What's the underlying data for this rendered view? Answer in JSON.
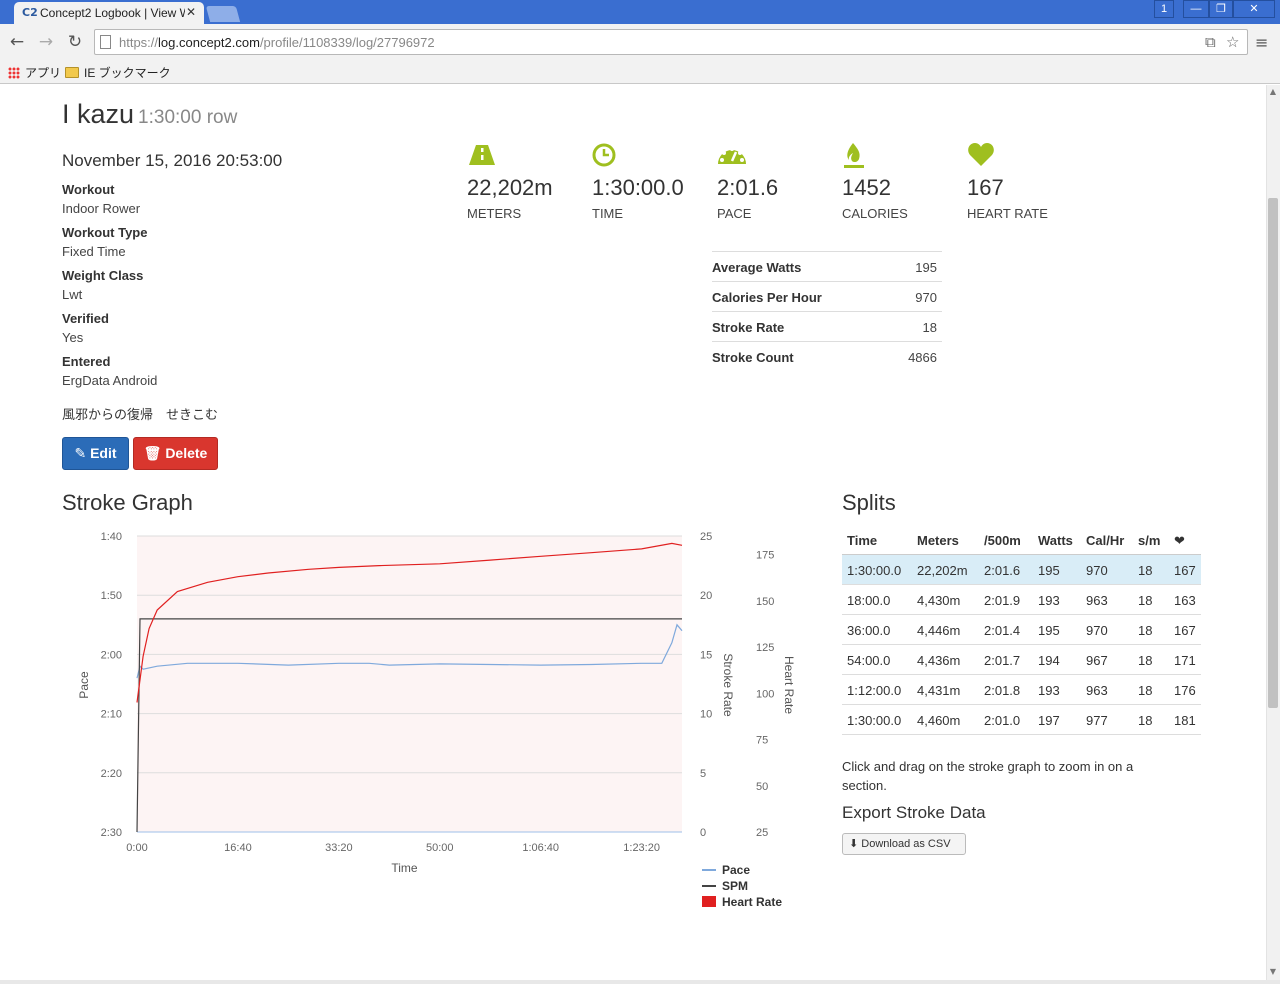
{
  "browser": {
    "tab_title": "Concept2 Logbook | View W",
    "tab_close": "✕",
    "url_scheme": "https://",
    "url_host": "log.concept2.com",
    "url_path": "/profile/1108339/log/27796972",
    "window_buttons": [
      "1",
      "—",
      "❐",
      "✕"
    ],
    "bookmarks": [
      {
        "label": "アプリ",
        "icon": "apps-grid-icon"
      },
      {
        "label": "IE ブックマーク",
        "icon": "folder-icon"
      }
    ]
  },
  "workout": {
    "name": "I kazu",
    "type_summary": "1:30:00 row",
    "date": "November 15, 2016 20:53:00",
    "details": [
      {
        "label": "Workout",
        "value": "Indoor Rower"
      },
      {
        "label": "Workout Type",
        "value": "Fixed Time"
      },
      {
        "label": "Weight Class",
        "value": "Lwt"
      },
      {
        "label": "Verified",
        "value": "Yes"
      },
      {
        "label": "Entered",
        "value": "ErgData Android"
      }
    ],
    "comment": "風邪からの復帰　せきこむ",
    "edit_label": "Edit",
    "delete_label": "Delete"
  },
  "stats": [
    {
      "value": "22,202m",
      "label": "METERS",
      "icon": "road-icon"
    },
    {
      "value": "1:30:00.0",
      "label": "TIME",
      "icon": "clock-icon"
    },
    {
      "value": "2:01.6",
      "label": "PACE",
      "icon": "speedometer-icon"
    },
    {
      "value": "1452",
      "label": "CALORIES",
      "icon": "flame-icon"
    },
    {
      "value": "167",
      "label": "HEART RATE",
      "icon": "heart-icon"
    }
  ],
  "metrics": [
    {
      "label": "Average Watts",
      "value": "195"
    },
    {
      "label": "Calories Per Hour",
      "value": "970"
    },
    {
      "label": "Stroke Rate",
      "value": "18"
    },
    {
      "label": "Stroke Count",
      "value": "4866"
    }
  ],
  "stroke_graph": {
    "heading": "Stroke Graph"
  },
  "splits": {
    "heading": "Splits",
    "columns": [
      "Time",
      "Meters",
      "/500m",
      "Watts",
      "Cal/Hr",
      "s/m",
      "heart-icon"
    ],
    "rows": [
      [
        "1:30:00.0",
        "22,202m",
        "2:01.6",
        "195",
        "970",
        "18",
        "167"
      ],
      [
        "18:00.0",
        "4,430m",
        "2:01.9",
        "193",
        "963",
        "18",
        "163"
      ],
      [
        "36:00.0",
        "4,446m",
        "2:01.4",
        "195",
        "970",
        "18",
        "167"
      ],
      [
        "54:00.0",
        "4,436m",
        "2:01.7",
        "194",
        "967",
        "18",
        "171"
      ],
      [
        "1:12:00.0",
        "4,431m",
        "2:01.8",
        "193",
        "963",
        "18",
        "176"
      ],
      [
        "1:30:00.0",
        "4,460m",
        "2:01.0",
        "197",
        "977",
        "18",
        "181"
      ]
    ]
  },
  "help_text": "Click and drag on the stroke graph to zoom in on a section.",
  "export": {
    "heading": "Export Stroke Data",
    "button_label": "Download as CSV"
  },
  "colors": {
    "accent_green": "#9fbf1f",
    "pace_line": "#7fa9dc",
    "spm_line": "#444444",
    "heart_rate_line": "#e02020",
    "edit_button": "#2b6cb8",
    "delete_button": "#d9362e",
    "split_total_bg": "#d9edf7"
  },
  "chart_data": {
    "type": "line",
    "xlabel": "Time",
    "x_ticks": [
      "0:00",
      "16:40",
      "33:20",
      "50:00",
      "1:06:40",
      "1:23:20"
    ],
    "x_tick_seconds": [
      0,
      1000,
      2000,
      3000,
      4000,
      5000
    ],
    "x_range_seconds": [
      0,
      5400
    ],
    "y_axes": [
      {
        "name": "Pace",
        "ticks": [
          "1:40",
          "1:50",
          "2:00",
          "2:10",
          "2:20",
          "2:30"
        ],
        "range_seconds_per_500m": [
          100,
          150
        ],
        "inverted": true
      },
      {
        "name": "Stroke Rate",
        "ticks": [
          "25",
          "20",
          "15",
          "10",
          "5",
          "0"
        ],
        "range": [
          0,
          25
        ]
      },
      {
        "name": "Heart Rate",
        "ticks": [
          "175",
          "150",
          "125",
          "100",
          "75",
          "50",
          "25"
        ],
        "range": [
          25,
          185
        ]
      }
    ],
    "series": [
      {
        "name": "Pace",
        "axis": "Pace",
        "x": [
          0,
          30,
          60,
          200,
          500,
          1000,
          1500,
          2000,
          2200,
          2300,
          2500,
          3000,
          3500,
          4000,
          4500,
          5000,
          5200,
          5300,
          5350,
          5400
        ],
        "values": [
          124,
          122,
          122.5,
          122,
          121.5,
          121.5,
          121.8,
          121.5,
          121.5,
          121.5,
          121.8,
          121.6,
          121.7,
          121.8,
          121.7,
          121.5,
          121.5,
          118,
          115,
          116
        ]
      },
      {
        "name": "SPM",
        "axis": "Stroke Rate",
        "x": [
          0,
          30,
          5400
        ],
        "values": [
          0,
          18,
          18
        ]
      },
      {
        "name": "Heart Rate",
        "axis": "Heart Rate",
        "x": [
          0,
          60,
          120,
          200,
          400,
          700,
          1000,
          1300,
          1700,
          2000,
          2400,
          3000,
          3500,
          4000,
          4500,
          5000,
          5300,
          5400
        ],
        "values": [
          95,
          120,
          135,
          145,
          155,
          160,
          163,
          165,
          167,
          168,
          169,
          170,
          172,
          174,
          176,
          178,
          181,
          180
        ]
      }
    ],
    "legend": [
      "Pace",
      "SPM",
      "Heart Rate"
    ],
    "legend_position": "bottom-right"
  }
}
